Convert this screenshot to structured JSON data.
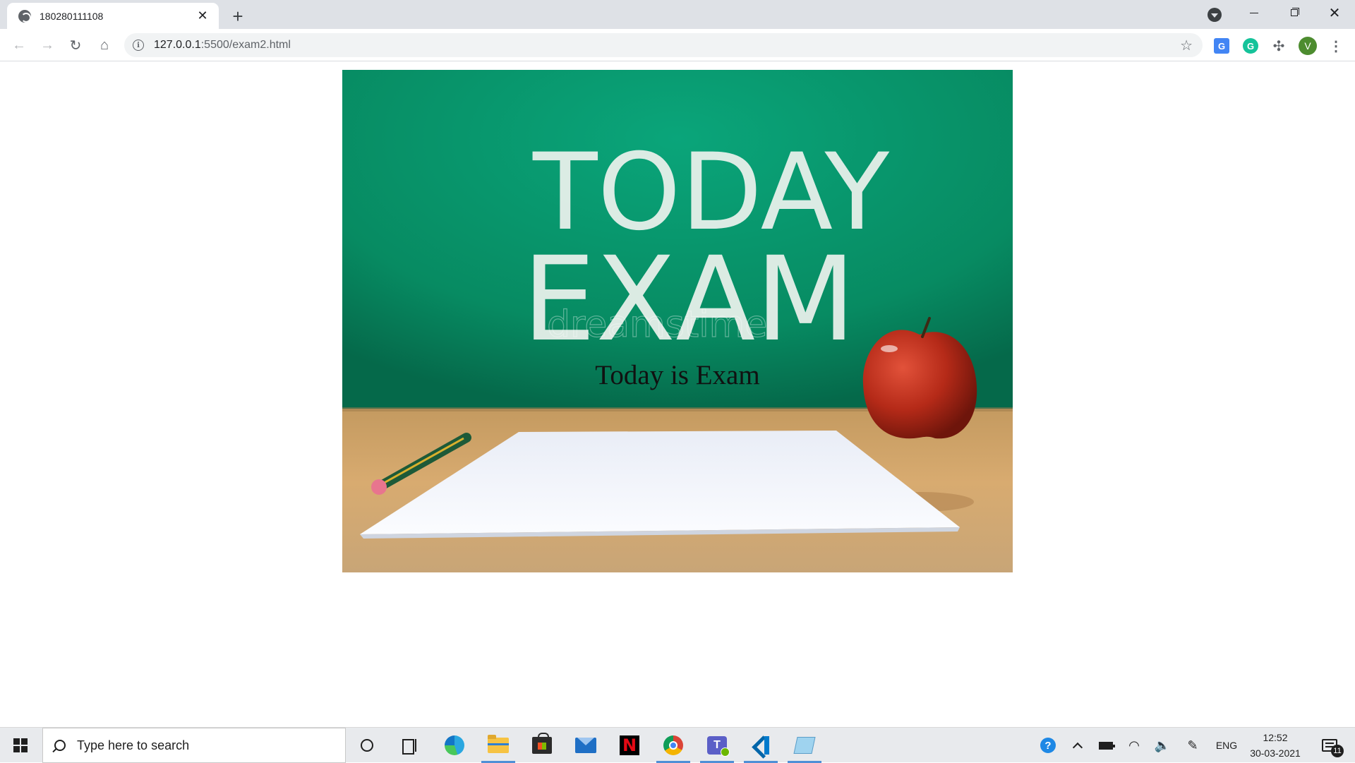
{
  "browser": {
    "tab": {
      "title": "180280111108",
      "close_glyph": "✕"
    },
    "new_tab_glyph": "+",
    "window_controls": {
      "close_glyph": "✕"
    },
    "nav": {
      "back_glyph": "←",
      "forward_glyph": "→",
      "reload_glyph": "↻",
      "home_glyph": "⌂"
    },
    "omnibox": {
      "host": "127.0.0.1",
      "path": ":5500/exam2.html",
      "info_glyph": "i",
      "star_glyph": "☆"
    },
    "extensions": {
      "translate_label": "G",
      "grammarly_label": "G",
      "puzzle_glyph": "✣",
      "profile_initial": "V",
      "menu_glyph": "⋮"
    }
  },
  "page": {
    "image": {
      "board_text_line1": "TODAY",
      "board_text_line2": "EXAM",
      "watermark": "dreamstime",
      "description_colors": {
        "board": "#08956a",
        "desk": "#d6a66a",
        "apple": "#b32818",
        "paper": "#f4f6fb"
      }
    },
    "caption": "Today is Exam"
  },
  "taskbar": {
    "search_placeholder": "Type here to search",
    "apps": [
      "edge-icon",
      "file-explorer-icon",
      "store-icon",
      "mail-icon",
      "netflix-icon",
      "chrome-icon",
      "teams-icon",
      "vscode-icon",
      "notepad-icon"
    ],
    "netflix_letter": "N",
    "teams_letter": "T",
    "tray": {
      "help_glyph": "?",
      "wifi_glyph": "◠",
      "volume_glyph": "🔈",
      "pen_glyph": "✎",
      "language": "ENG",
      "time": "12:52",
      "date": "30-03-2021",
      "notification_count": "11"
    }
  }
}
